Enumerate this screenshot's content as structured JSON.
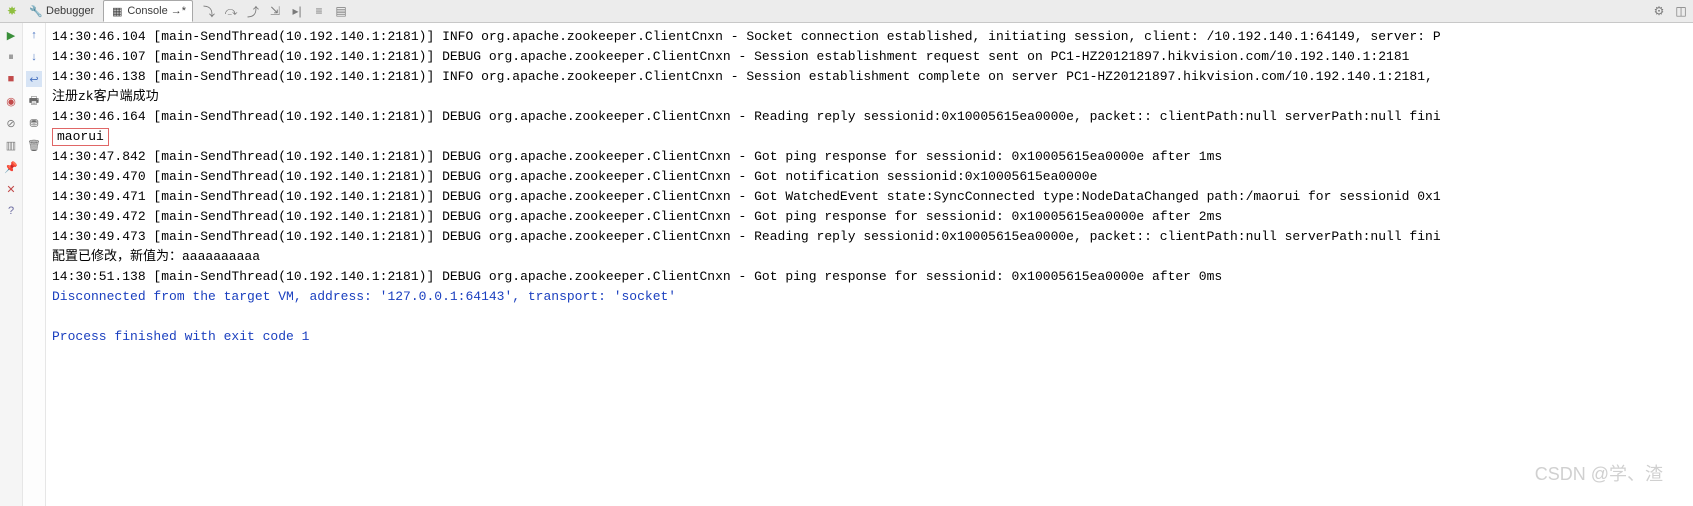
{
  "tabs": {
    "debugger": {
      "label": "Debugger"
    },
    "console": {
      "label": "Console →*"
    }
  },
  "toolbar_icons": {
    "step_into": "step-into",
    "step_over": "step-over",
    "step_out": "step-out",
    "step_smart": "smart-step",
    "run_to_cursor": "run-to-cursor",
    "evaluate": "evaluate",
    "dump": "dump"
  },
  "left1": {
    "resume": "resume",
    "pause": "pause",
    "stop": "stop",
    "view_bp": "view-breakpoints",
    "mute": "mute-breakpoints",
    "layout": "restore-layout",
    "pin": "pin",
    "close": "x",
    "help": "?"
  },
  "left2": {
    "up": "up",
    "down": "down",
    "wrap": "wrap",
    "print": "print",
    "filter": "filter",
    "trash": "trash"
  },
  "log": {
    "l0": "14:30:46.104 [main-SendThread(10.192.140.1:2181)] INFO org.apache.zookeeper.ClientCnxn - Socket connection established, initiating session, client: /10.192.140.1:64149, server: P",
    "l1": "14:30:46.107 [main-SendThread(10.192.140.1:2181)] DEBUG org.apache.zookeeper.ClientCnxn - Session establishment request sent on PC1-HZ20121897.hikvision.com/10.192.140.1:2181",
    "l2": "14:30:46.138 [main-SendThread(10.192.140.1:2181)] INFO org.apache.zookeeper.ClientCnxn - Session establishment complete on server PC1-HZ20121897.hikvision.com/10.192.140.1:2181,",
    "l3": "注册zk客户端成功",
    "l4": "14:30:46.164 [main-SendThread(10.192.140.1:2181)] DEBUG org.apache.zookeeper.ClientCnxn - Reading reply sessionid:0x10005615ea0000e, packet:: clientPath:null serverPath:null fini",
    "l5": "maorui",
    "l6": "14:30:47.842 [main-SendThread(10.192.140.1:2181)] DEBUG org.apache.zookeeper.ClientCnxn - Got ping response for sessionid: 0x10005615ea0000e after 1ms",
    "l7": "14:30:49.470 [main-SendThread(10.192.140.1:2181)] DEBUG org.apache.zookeeper.ClientCnxn - Got notification sessionid:0x10005615ea0000e",
    "l8": "14:30:49.471 [main-SendThread(10.192.140.1:2181)] DEBUG org.apache.zookeeper.ClientCnxn - Got WatchedEvent state:SyncConnected type:NodeDataChanged path:/maorui for sessionid 0x1",
    "l9": "14:30:49.472 [main-SendThread(10.192.140.1:2181)] DEBUG org.apache.zookeeper.ClientCnxn - Got ping response for sessionid: 0x10005615ea0000e after 2ms",
    "l10": "14:30:49.473 [main-SendThread(10.192.140.1:2181)] DEBUG org.apache.zookeeper.ClientCnxn - Reading reply sessionid:0x10005615ea0000e, packet:: clientPath:null serverPath:null fini",
    "l11": "配置已修改，新值为：aaaaaaaaaa",
    "l12": "14:30:51.138 [main-SendThread(10.192.140.1:2181)] DEBUG org.apache.zookeeper.ClientCnxn - Got ping response for sessionid: 0x10005615ea0000e after 0ms",
    "l13": "Disconnected from the target VM, address: '127.0.0.1:64143', transport: 'socket'",
    "l14": "Process finished with exit code 1"
  },
  "watermark": "CSDN @学、渣"
}
